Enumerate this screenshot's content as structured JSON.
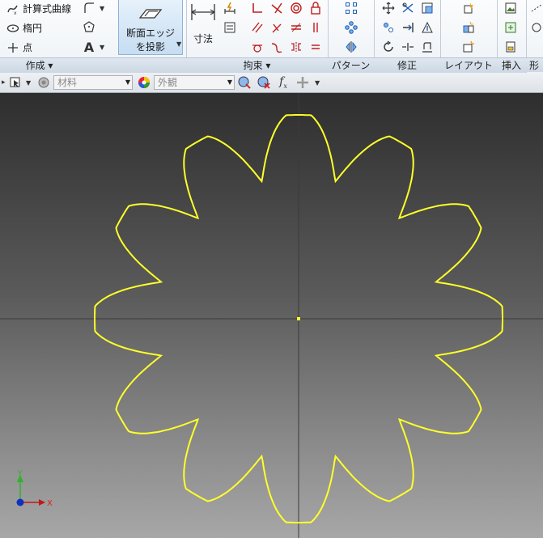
{
  "ribbon": {
    "draw_panel": {
      "items": [
        "計算式曲線",
        "楕円",
        "点"
      ],
      "footer": "作成"
    },
    "project_button": {
      "line1": "断面エッジ",
      "line2": "を投影"
    },
    "dimension": {
      "label": "寸法"
    },
    "constraint_panel": {
      "footer": "拘束"
    },
    "pattern_panel": {
      "footer": "パターン"
    },
    "modify_panel": {
      "footer": "修正"
    },
    "layout_panel": {
      "footer": "レイアウト"
    },
    "insert_panel": {
      "footer": "挿入"
    },
    "format_panel": {
      "footer": "形"
    }
  },
  "property_bar": {
    "material": "材料",
    "appearance": "外観",
    "fx": "f",
    "fx_sub": "x"
  },
  "canvas": {
    "sketch_color": "#ffff2a",
    "gear_teeth": 12,
    "axis_x": "X",
    "axis_y": "Y"
  }
}
